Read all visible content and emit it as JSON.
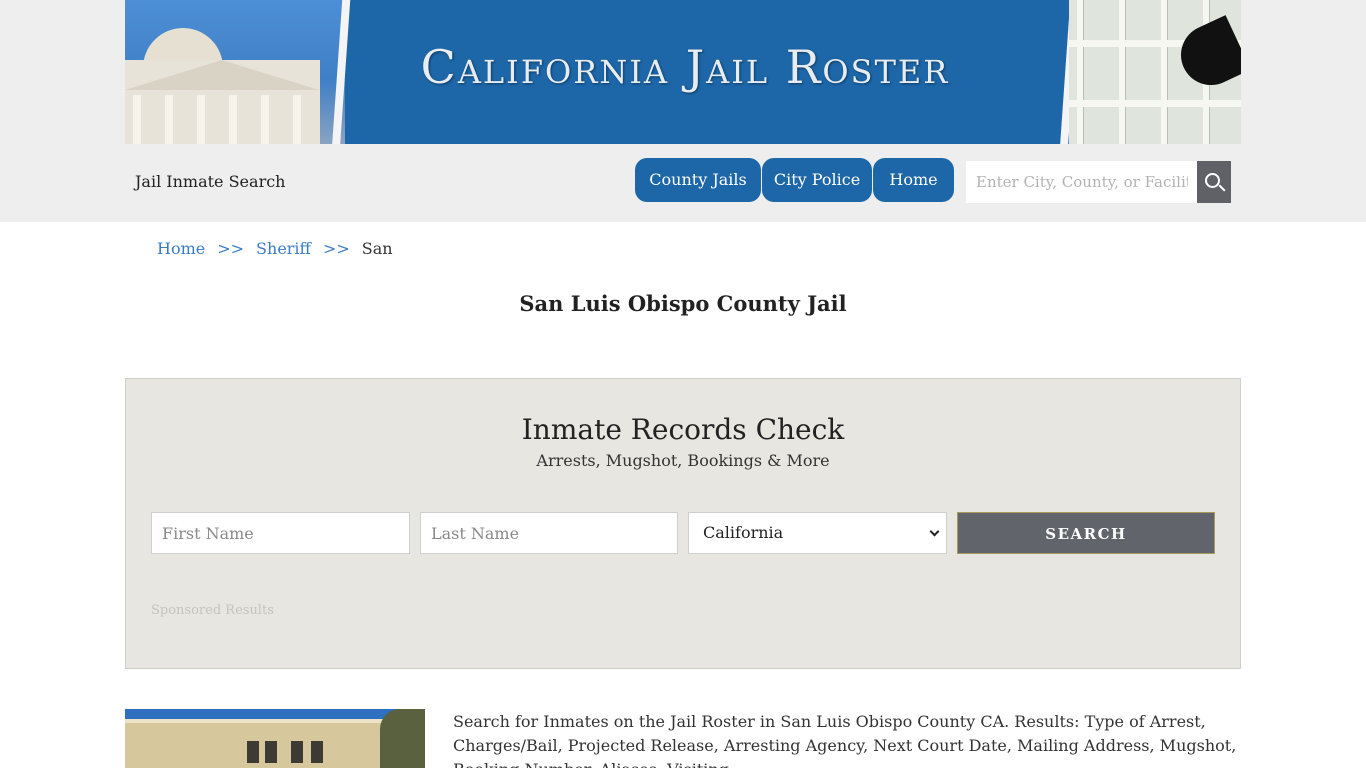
{
  "banner": {
    "title": "California Jail Roster"
  },
  "header": {
    "site_name": "Jail Inmate Search",
    "nav": [
      "County Jails",
      "City Police",
      "Home"
    ],
    "search_placeholder": "Enter City, County, or Facility",
    "brand_color": "#1d67a8"
  },
  "breadcrumb": {
    "items": [
      "Home",
      "Sheriff"
    ],
    "separator": ">>",
    "current": "San"
  },
  "page_title": "San Luis Obispo County Jail",
  "records": {
    "title": "Inmate Records Check",
    "subtitle": "Arrests, Mugshot, Bookings & More",
    "first_name_placeholder": "First Name",
    "last_name_placeholder": "Last Name",
    "state_selected": "California",
    "search_label": "SEARCH",
    "sponsored": "Sponsored Results"
  },
  "description": "Search for Inmates on the Jail Roster in San Luis Obispo County CA. Results: Type of Arrest, Charges/Bail, Projected Release, Arresting Agency, Next Court Date, Mailing Address, Mugshot, Booking Number, Aliases, Visiting"
}
